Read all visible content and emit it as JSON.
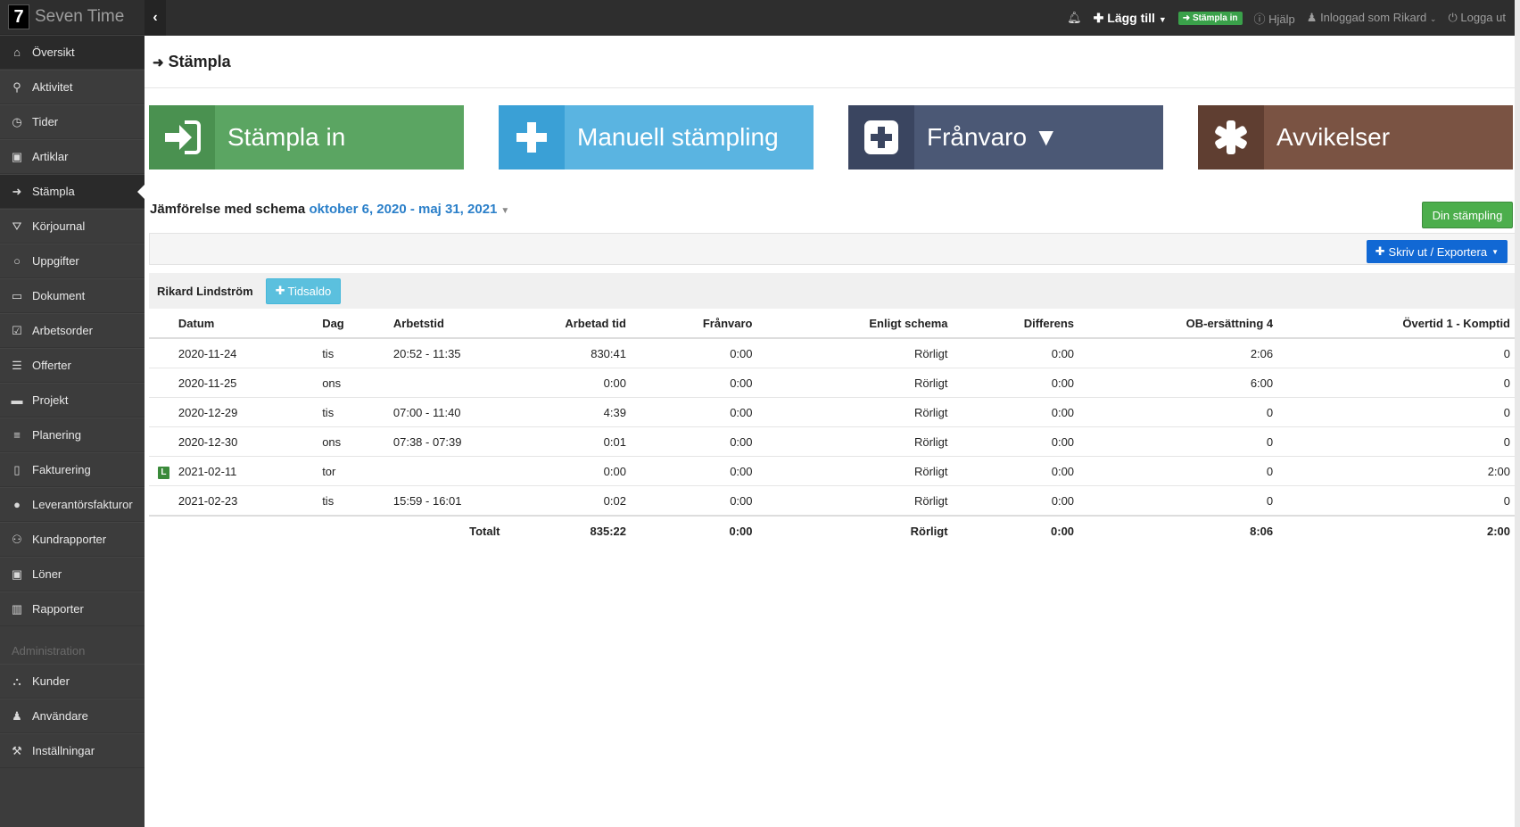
{
  "brand": {
    "logo": "7",
    "name": "Seven Time"
  },
  "sidebar": {
    "items": [
      {
        "label": "Översikt",
        "icon": "home-icon",
        "glyph": "⌂"
      },
      {
        "label": "Aktivitet",
        "icon": "map-marker-icon",
        "glyph": "⚲"
      },
      {
        "label": "Tider",
        "icon": "clock-icon",
        "glyph": "◷"
      },
      {
        "label": "Artiklar",
        "icon": "money-icon",
        "glyph": "▣"
      },
      {
        "label": "Stämpla",
        "icon": "sign-in-icon",
        "glyph": "➜"
      },
      {
        "label": "Körjournal",
        "icon": "road-icon",
        "glyph": "⛛"
      },
      {
        "label": "Uppgifter",
        "icon": "circle-icon",
        "glyph": "○"
      },
      {
        "label": "Dokument",
        "icon": "folder-icon",
        "glyph": "▭"
      },
      {
        "label": "Arbetsorder",
        "icon": "check-square-icon",
        "glyph": "☑"
      },
      {
        "label": "Offerter",
        "icon": "list-icon",
        "glyph": "☰"
      },
      {
        "label": "Projekt",
        "icon": "briefcase-icon",
        "glyph": "▬"
      },
      {
        "label": "Planering",
        "icon": "align-left-icon",
        "glyph": "≡"
      },
      {
        "label": "Fakturering",
        "icon": "file-icon",
        "glyph": "▯"
      },
      {
        "label": "Leverantörsfakturor",
        "icon": "dot-circle-icon",
        "glyph": "●"
      },
      {
        "label": "Kundrapporter",
        "icon": "handshake-icon",
        "glyph": "⚇"
      },
      {
        "label": "Löner",
        "icon": "money-icon",
        "glyph": "▣"
      },
      {
        "label": "Rapporter",
        "icon": "bar-chart-icon",
        "glyph": "▥"
      }
    ],
    "admin_heading": "Administration",
    "admin_items": [
      {
        "label": "Kunder",
        "icon": "sitemap-icon",
        "glyph": "⛬"
      },
      {
        "label": "Användare",
        "icon": "user-icon",
        "glyph": "♟"
      },
      {
        "label": "Inställningar",
        "icon": "wrench-icon",
        "glyph": "⚒"
      }
    ]
  },
  "topbar": {
    "add_label": "Lägg till",
    "stampla_badge": "Stämpla in",
    "help": "Hjälp",
    "logged_in": "Inloggad som Rikard",
    "logout": "Logga ut"
  },
  "page": {
    "title": "Stämpla"
  },
  "tiles": [
    {
      "label": "Stämpla in",
      "color": "#5ba562"
    },
    {
      "label": "Manuell stämpling",
      "color": "#5ab4e1"
    },
    {
      "label": "Frånvaro ▼",
      "color": "#4b5875"
    },
    {
      "label": "Avvikelser",
      "color": "#7a5343"
    }
  ],
  "compare": {
    "prefix": "Jämförelse med schema",
    "range": "oktober 6, 2020 - maj 31, 2021"
  },
  "buttons": {
    "din_stampling": "Din stämpling",
    "export": "Skriv ut / Exportera",
    "tidsaldo": "Tidsaldo"
  },
  "user": {
    "name": "Rikard Lindström"
  },
  "table": {
    "headers": [
      "Datum",
      "Dag",
      "Arbetstid",
      "Arbetad tid",
      "Frånvaro",
      "Enligt schema",
      "Differens",
      "OB-ersättning 4",
      "Övertid 1 - Komptid"
    ],
    "rows": [
      {
        "flag": "",
        "date": "2020-11-24",
        "day": "tis",
        "time": "20:52 - 11:35",
        "worked": "830:41",
        "absence": "0:00",
        "schedule": "Rörligt",
        "diff": "0:00",
        "ob": "2:06",
        "overtime": "0"
      },
      {
        "flag": "",
        "date": "2020-11-25",
        "day": "ons",
        "time": "",
        "worked": "0:00",
        "absence": "0:00",
        "schedule": "Rörligt",
        "diff": "0:00",
        "ob": "6:00",
        "overtime": "0"
      },
      {
        "flag": "",
        "date": "2020-12-29",
        "day": "tis",
        "time": "07:00 - 11:40",
        "worked": "4:39",
        "absence": "0:00",
        "schedule": "Rörligt",
        "diff": "0:00",
        "ob": "0",
        "overtime": "0"
      },
      {
        "flag": "",
        "date": "2020-12-30",
        "day": "ons",
        "time": "07:38 - 07:39",
        "worked": "0:01",
        "absence": "0:00",
        "schedule": "Rörligt",
        "diff": "0:00",
        "ob": "0",
        "overtime": "0"
      },
      {
        "flag": "L",
        "date": "2021-02-11",
        "day": "tor",
        "time": "",
        "worked": "0:00",
        "absence": "0:00",
        "schedule": "Rörligt",
        "diff": "0:00",
        "ob": "0",
        "overtime": "2:00"
      },
      {
        "flag": "",
        "date": "2021-02-23",
        "day": "tis",
        "time": "15:59 - 16:01",
        "worked": "0:02",
        "absence": "0:00",
        "schedule": "Rörligt",
        "diff": "0:00",
        "ob": "0",
        "overtime": "0"
      }
    ],
    "total": {
      "label": "Totalt",
      "worked": "835:22",
      "absence": "0:00",
      "schedule": "Rörligt",
      "diff": "0:00",
      "ob": "8:06",
      "overtime": "2:00"
    }
  }
}
